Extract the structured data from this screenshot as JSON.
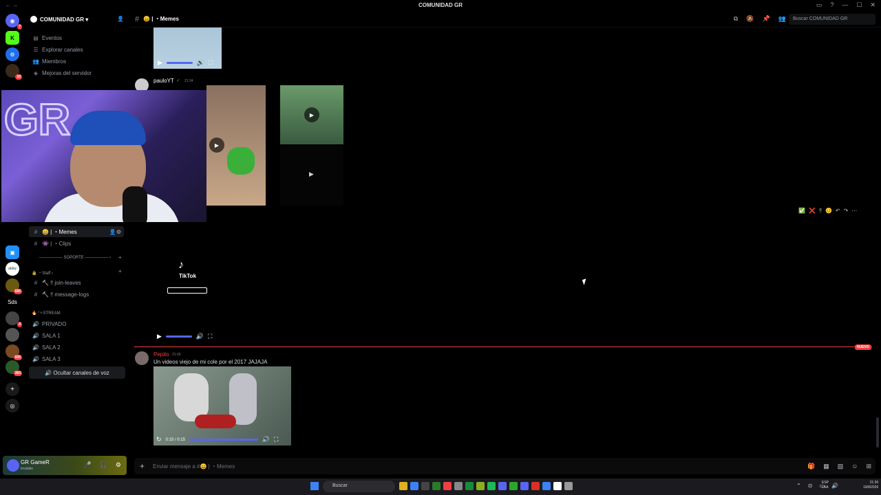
{
  "window": {
    "title": "COMUNIDAD GR",
    "nav_arrows": "← →",
    "controls": [
      "▭",
      "?",
      "—",
      "☐",
      "✕"
    ]
  },
  "servers": [
    {
      "icon": "discord-icon",
      "badge": "7"
    },
    {
      "icon": "kick-icon"
    },
    {
      "icon": "server-icon"
    },
    {
      "icon": "server-icon",
      "badge": "10"
    },
    {
      "icon": "box-icon"
    },
    {
      "label": "abbiy"
    },
    {
      "icon": "server-icon",
      "badge": "686"
    },
    {
      "label": "Sds"
    },
    {
      "icon": "server-icon",
      "badge": "4"
    },
    {
      "icon": "server-icon",
      "badge": "605"
    },
    {
      "icon": "server-icon",
      "badge": "383"
    },
    {
      "icon": "add-server-icon"
    },
    {
      "icon": "explore-icon"
    }
  ],
  "guild": {
    "name": "COMUNIDAD GR",
    "chevron": "▾",
    "menu": [
      {
        "label": "Eventos",
        "icon": "calendar-icon"
      },
      {
        "label": "Explorar canales",
        "icon": "list-icon"
      },
      {
        "label": "Miembros",
        "icon": "members-icon"
      },
      {
        "label": "Mejoras del servidor",
        "icon": "boost-icon"
      }
    ],
    "text_channels": [
      {
        "label": "😄 | ・Memes",
        "active": true
      },
      {
        "label": "👾 | ・Clips"
      }
    ],
    "category_soporte": "SOPORTE",
    "category_staff": "🔒 ・Staff ›",
    "staff_channels": [
      {
        "label": "🔨 ‼ join-leaves"
      },
      {
        "label": "🔨 ‼ message-logs"
      }
    ],
    "category_stream": "🔥 °✧STREAM",
    "voice_channels": [
      {
        "label": "PRIVADO"
      },
      {
        "label": "SALA 1"
      },
      {
        "label": "SALA 2"
      },
      {
        "label": "SALA 3"
      }
    ],
    "hide_voice_label": "Ocultar canales de voz"
  },
  "topbar": {
    "hash": "#",
    "channel": "😄 | ・Memes",
    "tools": [
      "threads-icon",
      "mute-icon",
      "pin-icon",
      "members-icon"
    ],
    "search_placeholder": "Buscar COMUNIDAD GR"
  },
  "messages": [
    {
      "author": "pauloYT",
      "author_color": "#ffffff",
      "badge": "✓",
      "time": "21:24",
      "kind": "media-grid"
    },
    {
      "kind": "tiktok-video",
      "tiktok_label": "TikTok"
    },
    {
      "author": "Pepito",
      "author_color": "#f23f43",
      "time": "21:29",
      "text": "Un videos viejo de mi cole por el 2017 JAJAJA",
      "video_time": "0:15 / 0:15"
    }
  ],
  "divider": {
    "label": "NUEVO"
  },
  "hover_actions": [
    "✅",
    "❌",
    "‼",
    "😊",
    "↶",
    "↷",
    "⋯"
  ],
  "composer": {
    "placeholder": "Enviar mensaje a #😄 | ・Memes",
    "plus": "+"
  },
  "user": {
    "name": "GR GameR",
    "status": "Invisible"
  },
  "taskbar": {
    "search": "Buscar",
    "lang_line1": "ESP",
    "lang_line2": "LAA",
    "time": "21:30",
    "date": "19/8/2026",
    "app_colors": [
      "#e0b020",
      "#3b82f6",
      "#444",
      "#2a7a2a",
      "#f23f43",
      "#888",
      "#1a8a3a",
      "#8ab020",
      "#1db954",
      "#5865f2",
      "#2ca52c",
      "#5865f2",
      "#d93025",
      "#3b82f6",
      "#fff",
      "#999"
    ]
  },
  "colors": {
    "accent": "#5865f2",
    "danger": "#f23f43",
    "bg": "#000000"
  }
}
